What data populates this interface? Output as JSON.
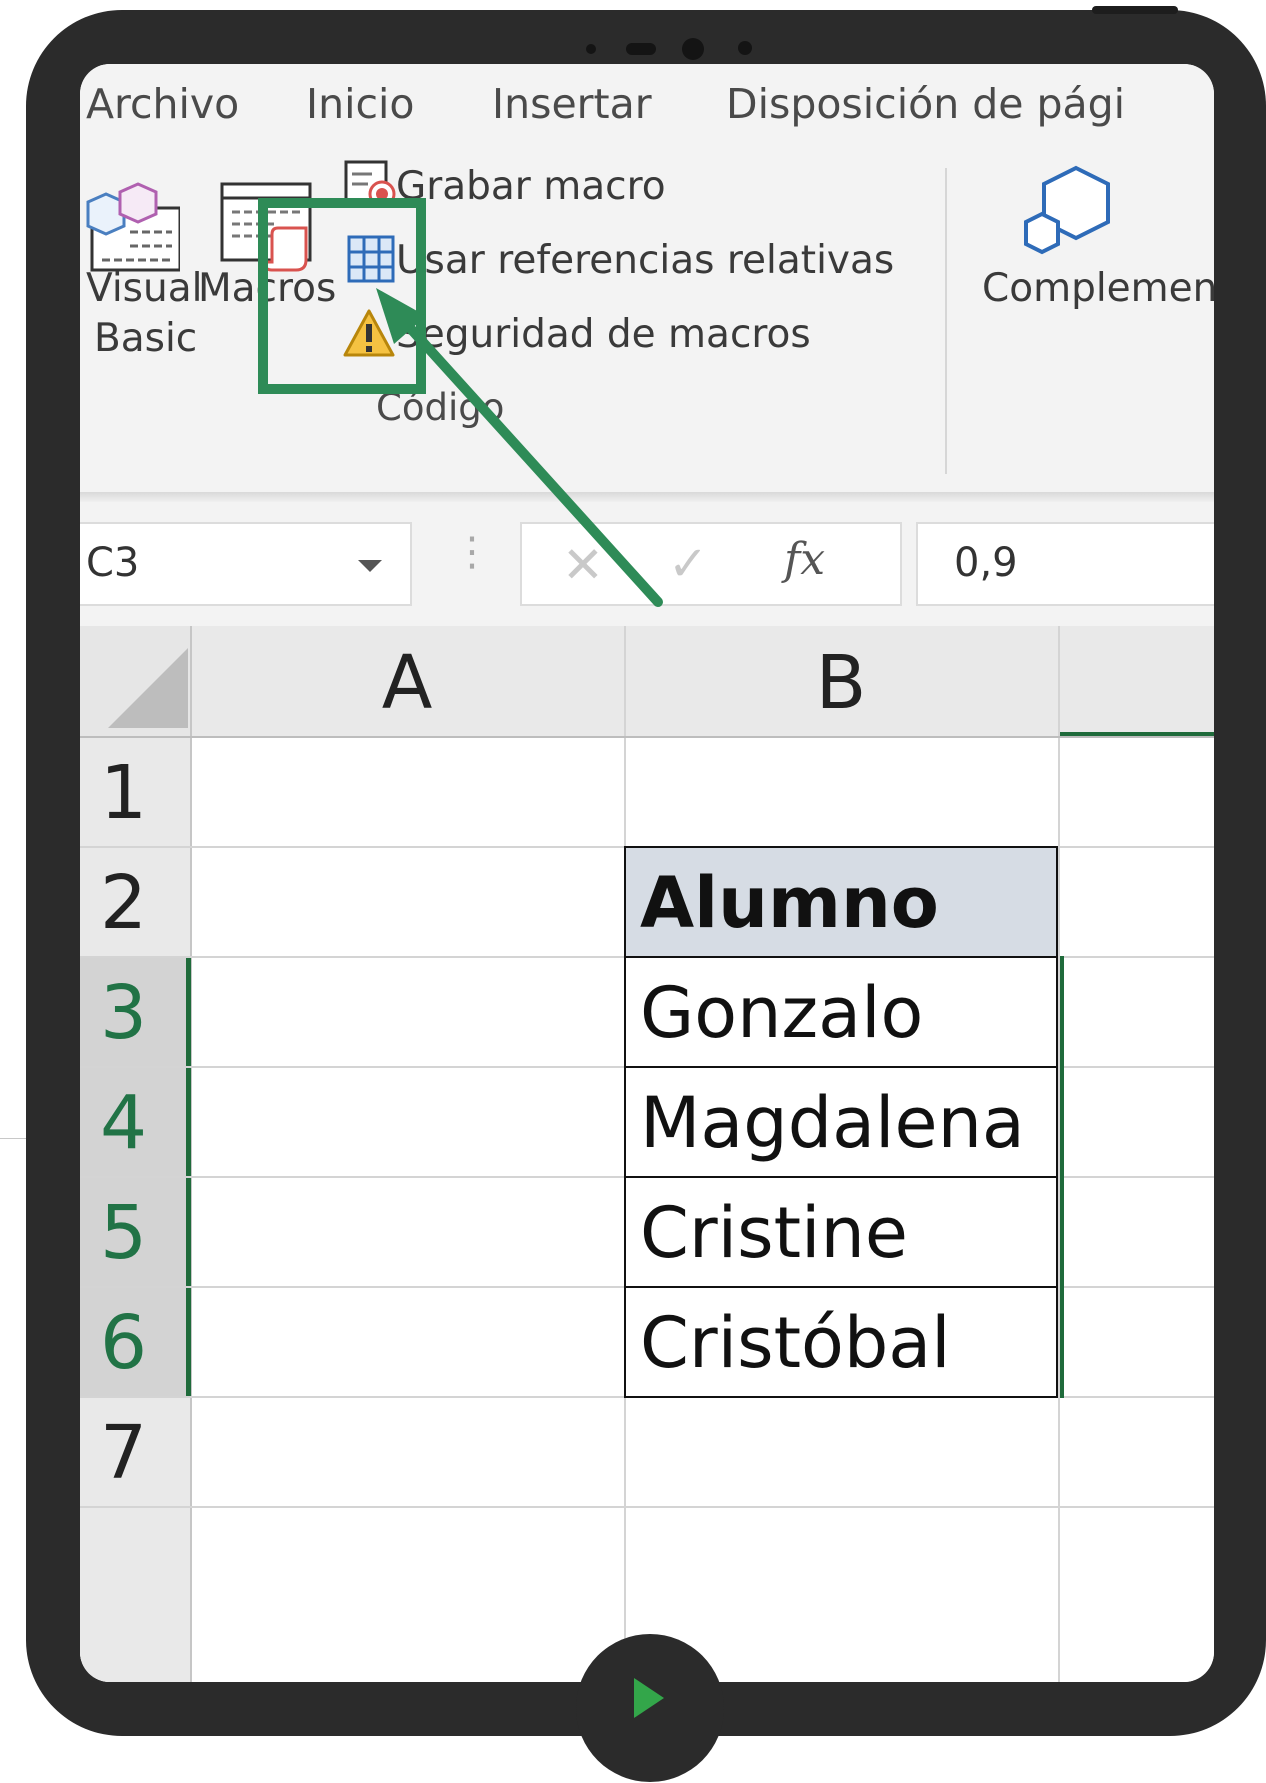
{
  "ribbon": {
    "tabs": [
      "Archivo",
      "Inicio",
      "Insertar",
      "Disposición de pági"
    ],
    "visual_basic_label_line1": "Visual",
    "visual_basic_label_line2": "Basic",
    "macros_label": "Macros",
    "record_macro_label": "Grabar macro",
    "relative_refs_label": "Usar referencias relativas",
    "macro_security_label": "Seguridad de macros",
    "group_label": "Código",
    "addins_label": "Complemen"
  },
  "formula_bar": {
    "name_box": "C3",
    "cancel_symbol": "✕",
    "confirm_symbol": "✓",
    "fx_symbol": "fx",
    "value": "0,9"
  },
  "sheet": {
    "columns": [
      "A",
      "B"
    ],
    "rows": [
      "1",
      "2",
      "3",
      "4",
      "5",
      "6",
      "7"
    ],
    "selected_rows": [
      "3",
      "4",
      "5",
      "6"
    ],
    "table": {
      "header": "Alumno",
      "values": [
        "Gonzalo",
        "Magdalena",
        "Cristine",
        "Cristóbal"
      ]
    }
  },
  "colors": {
    "accent_green": "#2e8b57",
    "excel_green": "#217346",
    "table_header_fill": "#d6dce4",
    "device_frame": "#2b2b2b"
  },
  "icons": [
    "visual-basic-icon",
    "macros-icon",
    "record-macro-icon",
    "relative-references-icon",
    "warning-icon",
    "addins-icon",
    "dropdown-arrow-icon",
    "play-icon"
  ]
}
